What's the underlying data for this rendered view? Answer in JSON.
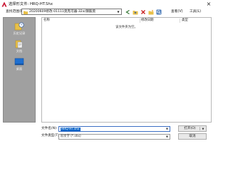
{
  "window": {
    "title": "选择形文件: HRQ-HT.Shx"
  },
  "toolbar": {
    "lookin_label": "查找范围(I):",
    "lookin_value": "20200609修改-01111莫克可器-32a(钢筋莫",
    "views_label": "查看(V)",
    "tools_label": "工具(L)",
    "icons": [
      "back-icon",
      "up-folder-icon",
      "delete-icon",
      "new-folder-icon",
      "search-web-icon"
    ]
  },
  "places": [
    {
      "label": "历史记录",
      "icon": "history-icon"
    },
    {
      "label": "文档",
      "icon": "documents-icon"
    },
    {
      "label": "桌面",
      "icon": "desktop-icon"
    }
  ],
  "file_list": {
    "columns": [
      "名称",
      "修改日期",
      "类型"
    ],
    "empty_message": "该文件夹为空。"
  },
  "footer": {
    "filename_label": "文件名(N):",
    "filename_value": "HRQ-HT.shx",
    "filetype_label": "文件类型(T):",
    "filetype_value": "形文字 (*.shx)",
    "open_button": "打开(O)",
    "cancel_button": "取消"
  },
  "colors": {
    "places_bg": "#a0a0a0",
    "selection": "#0a64c8",
    "app_icon": "#c8102e"
  }
}
